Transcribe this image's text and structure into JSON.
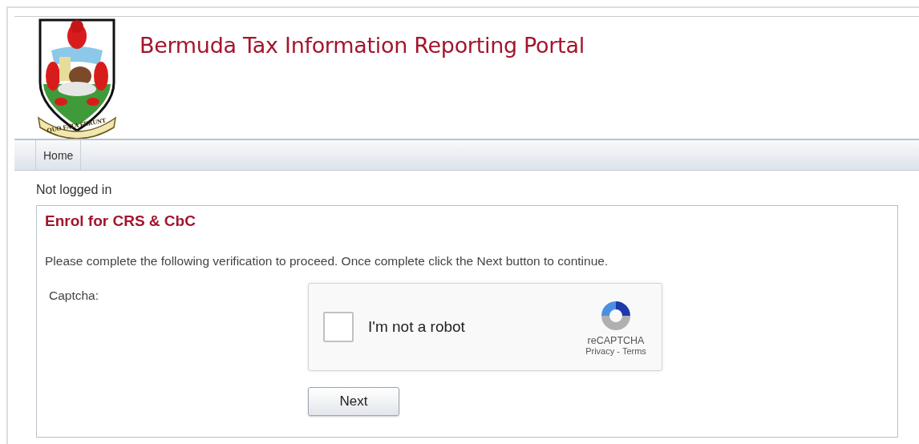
{
  "header": {
    "title": "Bermuda Tax Information Reporting Portal",
    "motto": "QUO FATA FERUNT"
  },
  "nav": {
    "items": [
      {
        "label": "Home"
      }
    ]
  },
  "login_status": "Not logged in",
  "panel": {
    "title": "Enrol for CRS & CbC",
    "instructions": "Please complete the following verification to proceed. Once complete click the Next button to continue.",
    "captcha_label": "Captcha:",
    "captcha": {
      "label": "I'm not a robot",
      "checked": false,
      "brand": "reCAPTCHA",
      "privacy": "Privacy",
      "separator": "-",
      "terms": "Terms"
    },
    "button": "Next"
  }
}
